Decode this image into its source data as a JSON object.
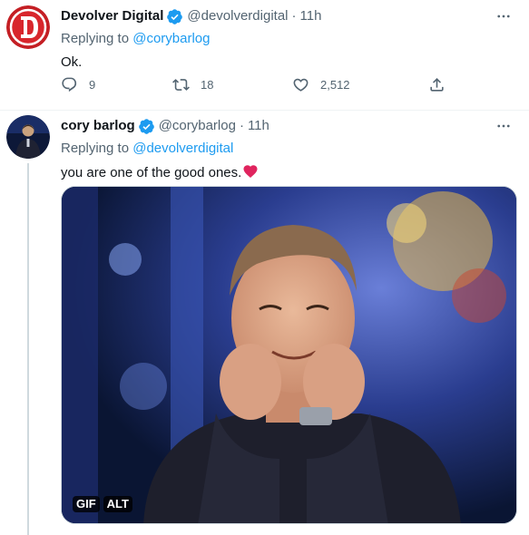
{
  "tweets": [
    {
      "display_name": "Devolver Digital",
      "handle": "@devolverdigital",
      "time": "11h",
      "replying_label": "Replying to",
      "replying_to": "@corybarlog",
      "text": "Ok.",
      "stats": {
        "replies": "9",
        "retweets": "18",
        "likes": "2,512"
      }
    },
    {
      "display_name": "cory barlog",
      "handle": "@corybarlog",
      "time": "11h",
      "replying_label": "Replying to",
      "replying_to": "@devolverdigital",
      "text": "you are one of the good ones.",
      "media": {
        "gif_badge": "GIF",
        "alt_badge": "ALT"
      }
    }
  ],
  "separator": "·",
  "icons": {
    "verified": "verified-badge-icon",
    "more": "more-icon",
    "reply": "reply-icon",
    "retweet": "retweet-icon",
    "like": "heart-icon",
    "share": "share-icon",
    "emoji": "red-heart-emoji"
  },
  "colors": {
    "accent": "#1d9bf0",
    "muted": "#536471",
    "text": "#0f1419",
    "heart": "#e0245e"
  }
}
